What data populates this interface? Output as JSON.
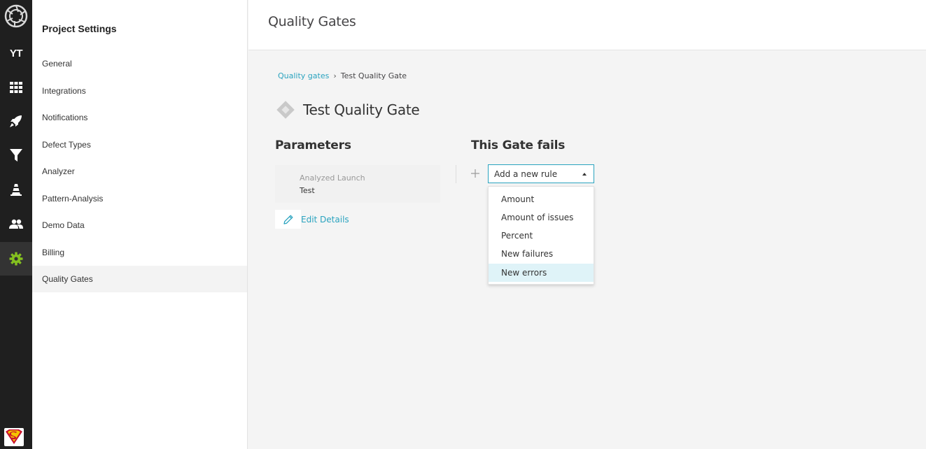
{
  "rail": {
    "project_initials": "YT",
    "icons": [
      "app-logo-icon",
      "project-avatar-yt",
      "dashboard-grid-icon",
      "launches-rocket-icon",
      "filters-funnel-icon",
      "debug-cone-icon",
      "members-icon",
      "settings-gear-icon",
      "user-avatar"
    ],
    "active_color": "#84c11f"
  },
  "sidebar": {
    "title": "Project Settings",
    "items": [
      {
        "label": "General"
      },
      {
        "label": "Integrations"
      },
      {
        "label": "Notifications"
      },
      {
        "label": "Defect Types"
      },
      {
        "label": "Analyzer"
      },
      {
        "label": "Pattern-Analysis"
      },
      {
        "label": "Demo Data"
      },
      {
        "label": "Billing"
      },
      {
        "label": "Quality Gates",
        "active": true
      }
    ]
  },
  "header": {
    "title": "Quality Gates"
  },
  "breadcrumb": {
    "parent": "Quality gates",
    "separator": "›",
    "current": "Test Quality Gate"
  },
  "gate": {
    "title": "Test Quality Gate"
  },
  "parameters": {
    "title": "Parameters",
    "label": "Analyzed Launch",
    "value": "Test",
    "edit_label": "Edit Details"
  },
  "rules": {
    "title": "This Gate fails",
    "select_placeholder": "Add a new rule",
    "options": [
      {
        "label": "Amount"
      },
      {
        "label": "Amount of issues"
      },
      {
        "label": "Percent"
      },
      {
        "label": "New failures"
      },
      {
        "label": "New errors",
        "highlighted": true
      }
    ]
  },
  "colors": {
    "accent": "#2aa3bf",
    "rail_bg": "#1f1f1f",
    "highlight": "#dff3f8"
  }
}
